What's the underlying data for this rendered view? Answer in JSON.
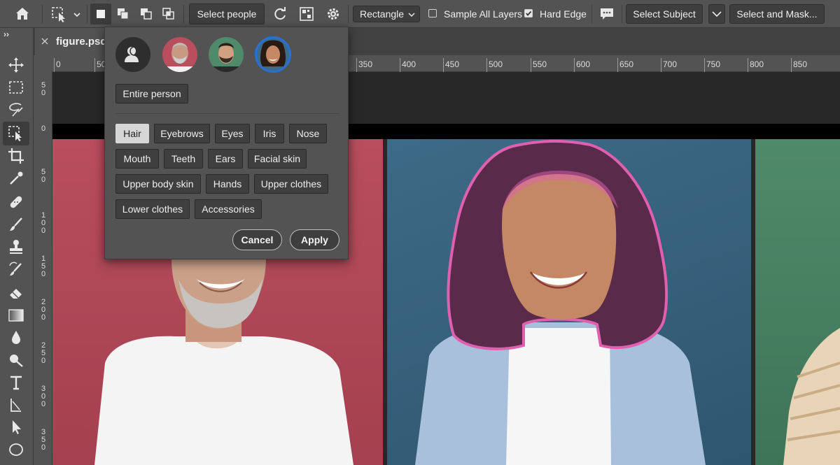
{
  "options_bar": {
    "select_people_label": "Select people",
    "shape_mode": "Rectangle",
    "sample_all_layers": {
      "label": "Sample All Layers",
      "checked": false
    },
    "hard_edge": {
      "label": "Hard Edge",
      "checked": true
    },
    "select_subject_label": "Select Subject",
    "select_and_mask_label": "Select and Mask..."
  },
  "document": {
    "tab_title": "figure.psd",
    "panel_toggle": "››"
  },
  "ruler": {
    "h_ticks": [
      "0",
      "50",
      "350",
      "400",
      "450",
      "500",
      "550",
      "600",
      "650",
      "700",
      "750",
      "800",
      "850"
    ],
    "v_ticks": [
      [
        "5",
        "0"
      ],
      [
        "0"
      ],
      [
        "5",
        "0"
      ],
      [
        "1",
        "0",
        "0"
      ],
      [
        "1",
        "5",
        "0"
      ],
      [
        "2",
        "0",
        "0"
      ],
      [
        "2",
        "5",
        "0"
      ],
      [
        "3",
        "0",
        "0"
      ],
      [
        "3",
        "5",
        "0"
      ]
    ]
  },
  "popover": {
    "entire_person_label": "Entire person",
    "parts": [
      {
        "label": "Hair",
        "selected": true
      },
      {
        "label": "Eyebrows"
      },
      {
        "label": "Eyes"
      },
      {
        "label": "Iris"
      },
      {
        "label": "Nose"
      },
      {
        "label": "Mouth"
      },
      {
        "label": "Teeth"
      },
      {
        "label": "Ears"
      },
      {
        "label": "Facial skin"
      },
      {
        "label": "Upper body skin"
      },
      {
        "label": "Hands"
      },
      {
        "label": "Upper clothes"
      },
      {
        "label": "Lower clothes"
      },
      {
        "label": "Accessories"
      }
    ],
    "cancel_label": "Cancel",
    "apply_label": "Apply"
  },
  "colors": {
    "ui_dark": "#535353",
    "selection_outline": "#e060b0",
    "hair_overlay": "#5a2a4a",
    "active_avatar_ring": "#2a6fd6"
  },
  "icons": [
    "home-icon",
    "object-selection-tool-icon",
    "chevron-down-icon",
    "new-selection-icon",
    "add-to-selection-icon",
    "subtract-from-selection-icon",
    "intersect-selection-icon",
    "refresh-icon",
    "object-finder-icon",
    "gear-icon",
    "speech-bubble-icon",
    "move-tool-icon",
    "marquee-tool-icon",
    "lasso-tool-icon",
    "crop-tool-icon",
    "eyedropper-tool-icon",
    "healing-brush-icon",
    "brush-tool-icon",
    "clone-stamp-icon",
    "history-brush-icon",
    "eraser-tool-icon",
    "gradient-tool-icon",
    "blur-tool-icon",
    "dodge-tool-icon",
    "type-tool-icon",
    "path-selection-icon",
    "direct-selection-icon",
    "ellipse-tool-icon",
    "person-silhouette-icon",
    "close-icon"
  ]
}
